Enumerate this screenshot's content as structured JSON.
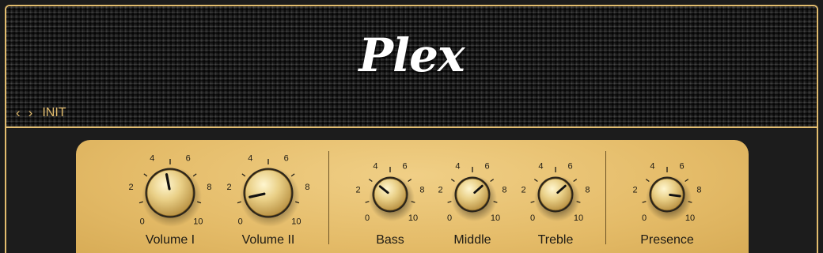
{
  "brand": {
    "logo_text": "Plex"
  },
  "preset": {
    "prev_icon": "chevron-left-icon",
    "next_icon": "chevron-right-icon",
    "name": "INIT"
  },
  "scale": {
    "labels": [
      "0",
      "2",
      "4",
      "6",
      "8",
      "10"
    ]
  },
  "knobs": [
    {
      "id": "volume-1",
      "label": "Volume I",
      "value": 4.6,
      "size": "large"
    },
    {
      "id": "volume-2",
      "label": "Volume II",
      "value": 1.2,
      "size": "large"
    },
    {
      "id": "bass",
      "label": "Bass",
      "value": 3.1,
      "size": "small"
    },
    {
      "id": "middle",
      "label": "Middle",
      "value": 6.8,
      "size": "small"
    },
    {
      "id": "treble",
      "label": "Treble",
      "value": 6.8,
      "size": "small"
    },
    {
      "id": "presence",
      "label": "Presence",
      "value": 8.6,
      "size": "small"
    }
  ],
  "colors": {
    "accent": "#e2bc6e",
    "panel": "#e4bb68",
    "grille": "#1e1e1e"
  }
}
